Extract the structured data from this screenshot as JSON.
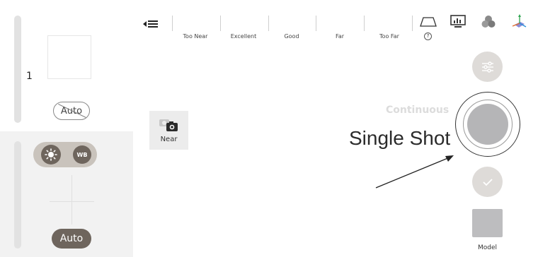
{
  "left_panel": {
    "level_number": "1",
    "focus_mode_label": "Auto",
    "toggle": {
      "exposure_icon": "sun-icon",
      "wb_label": "WB"
    },
    "auto_button_label": "Auto"
  },
  "distance_bar": {
    "labels": [
      "Too Near",
      "Excellent",
      "Good",
      "Far",
      "Too Far"
    ],
    "help_glyph": "?"
  },
  "top_icons": [
    "trapezoid-icon",
    "monitor-chart-icon",
    "color-circles-icon",
    "axes-icon"
  ],
  "near_button": {
    "label": "Near",
    "icon": "camera-switch-icon"
  },
  "capture": {
    "continuous_label": "Continuous",
    "single_shot_label": "Single Shot"
  },
  "model": {
    "label": "Model"
  },
  "colors": {
    "panel_bg": "#f2f2f2",
    "toggle_bg": "#c9c3bc",
    "dark_pill": "#6e655d",
    "shutter_fill": "#b5b5b7",
    "round_btn": "#dedbd8"
  }
}
